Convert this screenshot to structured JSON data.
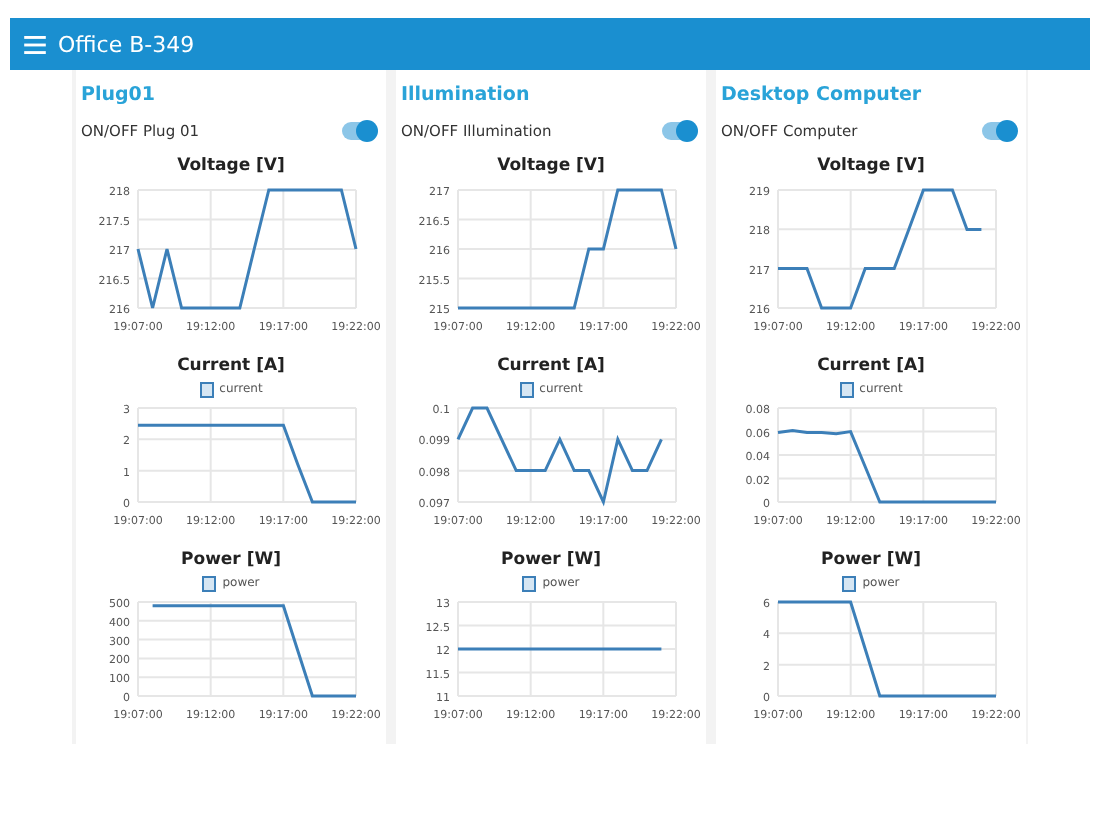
{
  "header": {
    "title": "Office B-349"
  },
  "groups": [
    {
      "title": "Plug01",
      "switch": {
        "label": "ON/OFF Plug 01",
        "on": true
      },
      "charts": [
        {
          "chart_data": {
            "type": "line",
            "title": "Voltage [V]",
            "categories": [
              "19:07:00",
              null,
              null,
              null,
              null,
              "19:12:00",
              null,
              null,
              null,
              null,
              "19:17:00",
              null,
              null,
              null,
              null,
              "19:22:00"
            ],
            "series": [
              {
                "color": "#3c7fb8",
                "values": [
                  217,
                  216,
                  217,
                  216,
                  216,
                  216,
                  216,
                  216,
                  217,
                  218,
                  218,
                  218,
                  218,
                  218,
                  218,
                  217
                ]
              }
            ],
            "ylim": [
              216,
              218
            ],
            "yticks": [
              216,
              216.5,
              217,
              217.5,
              218
            ],
            "grid": true
          }
        },
        {
          "chart_data": {
            "type": "line",
            "title": "Current [A]",
            "categories": [
              "19:07:00",
              null,
              null,
              null,
              null,
              "19:12:00",
              null,
              null,
              null,
              null,
              "19:17:00",
              null,
              null,
              null,
              null,
              "19:22:00"
            ],
            "series": [
              {
                "name": "current",
                "color": "#3c7fb8",
                "values": [
                  2.45,
                  2.45,
                  2.45,
                  2.45,
                  2.45,
                  2.45,
                  2.45,
                  2.45,
                  2.45,
                  2.45,
                  2.45,
                  1.2,
                  0,
                  0,
                  0,
                  0
                ]
              }
            ],
            "ylim": [
              0,
              3
            ],
            "yticks": [
              0,
              1,
              2,
              3
            ],
            "grid": true
          }
        },
        {
          "chart_data": {
            "type": "line",
            "title": "Power [W]",
            "categories": [
              "19:07:00",
              null,
              null,
              null,
              null,
              "19:12:00",
              null,
              null,
              null,
              null,
              "19:17:00",
              null,
              null,
              null,
              null,
              "19:22:00"
            ],
            "series": [
              {
                "name": "power",
                "color": "#3c7fb8",
                "values": [
                  null,
                  480,
                  480,
                  480,
                  480,
                  480,
                  480,
                  480,
                  480,
                  480,
                  480,
                  240,
                  0,
                  0,
                  0,
                  0
                ]
              }
            ],
            "ylim": [
              0,
              500
            ],
            "yticks": [
              0,
              100,
              200,
              300,
              400,
              500
            ],
            "grid": true
          }
        }
      ]
    },
    {
      "title": "Illumination",
      "switch": {
        "label": "ON/OFF Illumination",
        "on": true
      },
      "charts": [
        {
          "chart_data": {
            "type": "line",
            "title": "Voltage [V]",
            "categories": [
              "19:07:00",
              null,
              null,
              null,
              null,
              "19:12:00",
              null,
              null,
              null,
              null,
              "19:17:00",
              null,
              null,
              null,
              null,
              "19:22:00"
            ],
            "series": [
              {
                "color": "#3c7fb8",
                "values": [
                  215,
                  215,
                  215,
                  215,
                  215,
                  215,
                  215,
                  215,
                  215,
                  216,
                  216,
                  217,
                  217,
                  217,
                  217,
                  216
                ]
              }
            ],
            "ylim": [
              215,
              217
            ],
            "yticks": [
              215,
              215.5,
              216,
              216.5,
              217
            ],
            "grid": true
          }
        },
        {
          "chart_data": {
            "type": "line",
            "title": "Current [A]",
            "categories": [
              "19:07:00",
              null,
              null,
              null,
              null,
              "19:12:00",
              null,
              null,
              null,
              null,
              "19:17:00",
              null,
              null,
              null,
              null,
              "19:22:00"
            ],
            "series": [
              {
                "name": "current",
                "color": "#3c7fb8",
                "values": [
                  0.099,
                  0.1,
                  0.1,
                  0.099,
                  0.098,
                  0.098,
                  0.098,
                  0.099,
                  0.098,
                  0.098,
                  0.097,
                  0.099,
                  0.098,
                  0.098,
                  0.099,
                  null
                ]
              }
            ],
            "ylim": [
              0.097,
              0.1
            ],
            "yticks": [
              0.097,
              0.098,
              0.099,
              0.1
            ],
            "grid": true
          }
        },
        {
          "chart_data": {
            "type": "line",
            "title": "Power [W]",
            "categories": [
              "19:07:00",
              null,
              null,
              null,
              null,
              "19:12:00",
              null,
              null,
              null,
              null,
              "19:17:00",
              null,
              null,
              null,
              null,
              "19:22:00"
            ],
            "series": [
              {
                "name": "power",
                "color": "#3c7fb8",
                "values": [
                  12,
                  12,
                  12,
                  12,
                  12,
                  12,
                  12,
                  12,
                  12,
                  12,
                  12,
                  12,
                  12,
                  12,
                  12,
                  null
                ]
              }
            ],
            "ylim": [
              11,
              13
            ],
            "yticks": [
              11,
              11.5,
              12,
              12.5,
              13
            ],
            "grid": true
          }
        }
      ]
    },
    {
      "title": "Desktop Computer",
      "switch": {
        "label": "ON/OFF Computer",
        "on": true
      },
      "charts": [
        {
          "chart_data": {
            "type": "line",
            "title": "Voltage [V]",
            "categories": [
              "19:07:00",
              null,
              null,
              null,
              null,
              "19:12:00",
              null,
              null,
              null,
              null,
              "19:17:00",
              null,
              null,
              null,
              null,
              "19:22:00"
            ],
            "series": [
              {
                "color": "#3c7fb8",
                "values": [
                  217,
                  217,
                  217,
                  216,
                  216,
                  216,
                  217,
                  217,
                  217,
                  218,
                  219,
                  219,
                  219,
                  218,
                  218,
                  null
                ]
              }
            ],
            "ylim": [
              216,
              219
            ],
            "yticks": [
              216,
              217,
              218,
              219
            ],
            "grid": true
          }
        },
        {
          "chart_data": {
            "type": "line",
            "title": "Current [A]",
            "categories": [
              "19:07:00",
              null,
              null,
              null,
              null,
              "19:12:00",
              null,
              null,
              null,
              null,
              "19:17:00",
              null,
              null,
              null,
              null,
              "19:22:00"
            ],
            "series": [
              {
                "name": "current",
                "color": "#3c7fb8",
                "values": [
                  0.059,
                  0.061,
                  0.059,
                  0.059,
                  0.058,
                  0.06,
                  0.03,
                  0,
                  0,
                  0,
                  0,
                  0,
                  0,
                  0,
                  0,
                  0
                ]
              }
            ],
            "ylim": [
              0,
              0.08
            ],
            "yticks": [
              0,
              0.02,
              0.04,
              0.06,
              0.08
            ],
            "grid": true
          }
        },
        {
          "chart_data": {
            "type": "line",
            "title": "Power [W]",
            "categories": [
              "19:07:00",
              null,
              null,
              null,
              null,
              "19:12:00",
              null,
              null,
              null,
              null,
              "19:17:00",
              null,
              null,
              null,
              null,
              "19:22:00"
            ],
            "series": [
              {
                "name": "power",
                "color": "#3c7fb8",
                "values": [
                  6,
                  6,
                  6,
                  6,
                  6,
                  6,
                  3,
                  0,
                  0,
                  0,
                  0,
                  0,
                  0,
                  0,
                  0,
                  0
                ]
              }
            ],
            "ylim": [
              0,
              6
            ],
            "yticks": [
              0,
              2,
              4,
              6
            ],
            "grid": true
          }
        }
      ]
    }
  ]
}
